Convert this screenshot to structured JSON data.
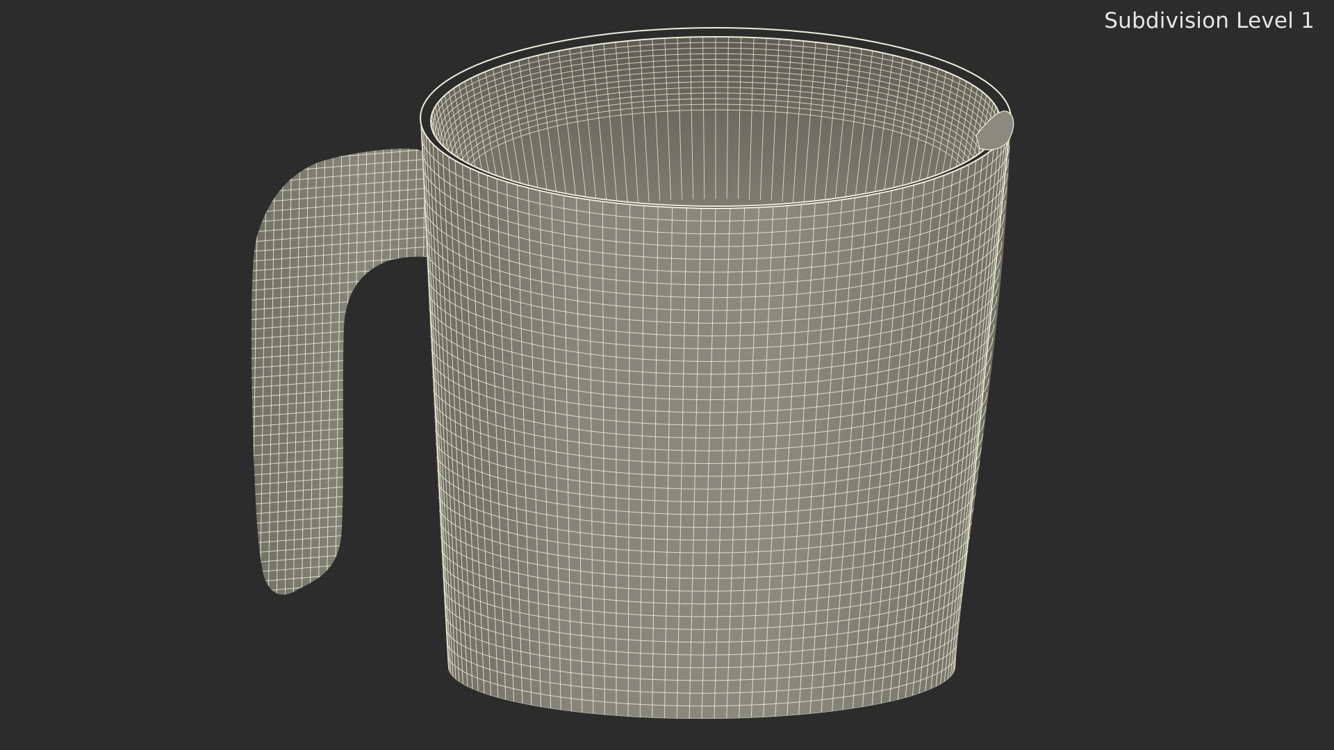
{
  "viewport": {
    "label": "Subdivision Level 1"
  },
  "render": {
    "background_color": "#2c2c2c",
    "surface_color": "#7f7f72",
    "inner_surface_color": "#6f6f64",
    "wire_color": "#f0eedc",
    "model": "measuring-cup-wireframe"
  }
}
